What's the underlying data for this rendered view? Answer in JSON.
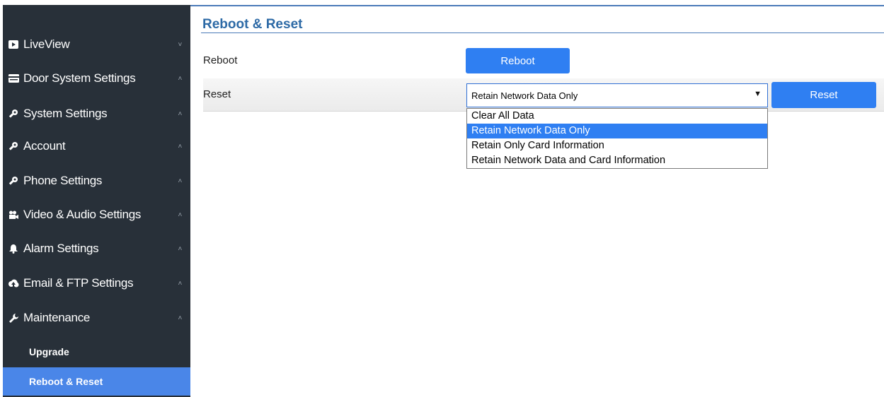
{
  "sidebar": {
    "items": [
      {
        "label": "LiveView",
        "icon": "video-icon",
        "chevron": "˅"
      },
      {
        "label": "Door System Settings",
        "icon": "card-icon",
        "chevron": "˄"
      },
      {
        "label": "System Settings",
        "icon": "key-icon",
        "chevron": "˄"
      },
      {
        "label": "Account",
        "icon": "key-icon",
        "chevron": "˄"
      },
      {
        "label": "Phone Settings",
        "icon": "key-icon",
        "chevron": "˄"
      },
      {
        "label": "Video & Audio Settings",
        "icon": "camera-icon",
        "chevron": "˄"
      },
      {
        "label": "Alarm Settings",
        "icon": "bell-icon",
        "chevron": "˄"
      },
      {
        "label": "Email & FTP Settings",
        "icon": "cloud-icon",
        "chevron": "˄"
      },
      {
        "label": "Maintenance",
        "icon": "wrench-icon",
        "chevron": "˄"
      }
    ],
    "sub_items": [
      {
        "label": "Upgrade"
      },
      {
        "label": "Reboot & Reset"
      }
    ]
  },
  "main": {
    "title": "Reboot & Reset",
    "reboot_label": "Reboot",
    "reboot_button": "Reboot",
    "reset_label": "Reset",
    "reset_button": "Reset",
    "reset_select": {
      "value": "Retain Network Data Only",
      "options": [
        "Clear All Data",
        "Retain Network Data Only",
        "Retain Only Card Information",
        "Retain Network Data and Card Information"
      ],
      "selected_index": 1
    }
  },
  "colors": {
    "sidebar_bg": "#283039",
    "accent": "#2f7ff2",
    "active_sub": "#4a86e8",
    "title": "#2d6aa6"
  }
}
